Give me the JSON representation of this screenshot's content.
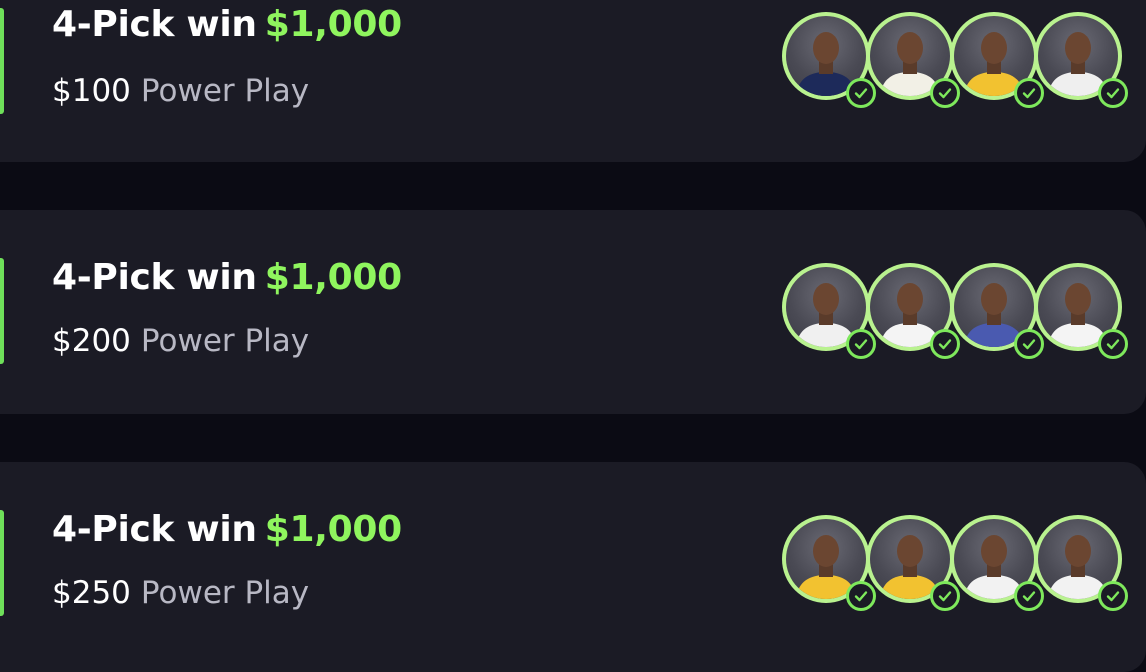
{
  "cards": [
    {
      "title_prefix": "4-Pick win",
      "amount": "$1,000",
      "stake": "$100",
      "type": "Power Play",
      "players": [
        {
          "icon": "player-avatar",
          "jersey": "#1d2a5a"
        },
        {
          "icon": "player-avatar",
          "jersey": "#f2f0e6"
        },
        {
          "icon": "player-avatar",
          "jersey": "#f2c230"
        },
        {
          "icon": "player-avatar",
          "jersey": "#efefef"
        }
      ]
    },
    {
      "title_prefix": "4-Pick win",
      "amount": "$1,000",
      "stake": "$200",
      "type": "Power Play",
      "players": [
        {
          "icon": "player-avatar",
          "jersey": "#f0f0f0"
        },
        {
          "icon": "player-avatar",
          "jersey": "#f4f4f4"
        },
        {
          "icon": "player-avatar",
          "jersey": "#4a5ab0"
        },
        {
          "icon": "player-avatar",
          "jersey": "#f4f4f4"
        }
      ]
    },
    {
      "title_prefix": "4-Pick win",
      "amount": "$1,000",
      "stake": "$250",
      "type": "Power Play",
      "players": [
        {
          "icon": "player-avatar",
          "jersey": "#f2c230"
        },
        {
          "icon": "player-avatar",
          "jersey": "#f2c230"
        },
        {
          "icon": "player-avatar",
          "jersey": "#f2f2f2"
        },
        {
          "icon": "player-avatar",
          "jersey": "#f2f2f2"
        }
      ]
    }
  ],
  "colors": {
    "background": "#0b0b14",
    "card": "#1b1b25",
    "accent": "#6fe05a",
    "amount": "#8ff55e",
    "subtitle": "#b8b8c4"
  }
}
